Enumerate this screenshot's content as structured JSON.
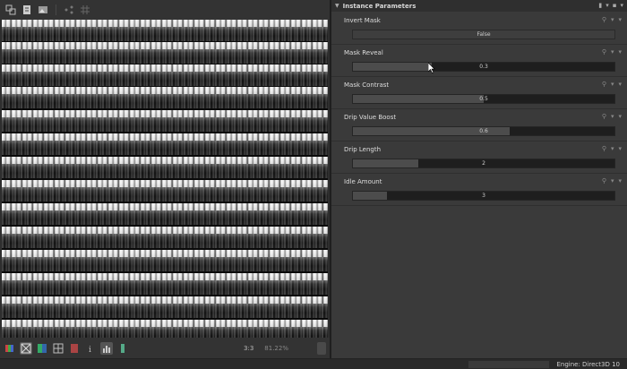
{
  "viewer": {
    "toolbar_icons": [
      "node-icon",
      "edit-icon",
      "image-icon",
      "share-icon",
      "grid-icon"
    ],
    "bottom_icons": [
      "channels-icon",
      "transparency-icon",
      "rgb-icon",
      "tiling-icon",
      "bookmark-icon",
      "info-icon",
      "histogram-icon",
      "color-icon"
    ],
    "zoom": "3:3",
    "resolution": "81.22%"
  },
  "params_panel": {
    "title": "Instance Parameters",
    "params": [
      {
        "label": "Invert Mask",
        "type": "toggle",
        "value": "False"
      },
      {
        "label": "Mask Reveal",
        "type": "slider",
        "value": "0.3",
        "fill": 0.3
      },
      {
        "label": "Mask Contrast",
        "type": "slider",
        "value": "0.5",
        "fill": 0.5
      },
      {
        "label": "Drip Value Boost",
        "type": "slider",
        "value": "0.6",
        "fill": 0.6
      },
      {
        "label": "Drip Length",
        "type": "slider",
        "value": "2",
        "fill": 0.25
      },
      {
        "label": "Idle Amount",
        "type": "slider",
        "value": "3",
        "fill": 0.13
      }
    ]
  },
  "status": {
    "engine": "Engine: Direct3D 10"
  }
}
